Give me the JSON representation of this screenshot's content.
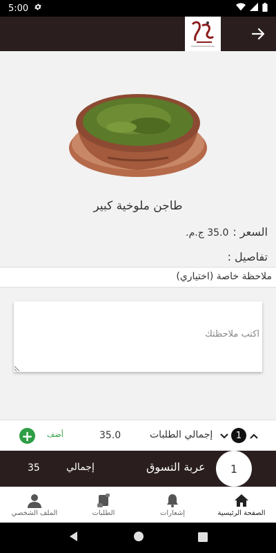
{
  "status_bar": {
    "time": "5:00"
  },
  "product": {
    "name": "طاجن ملوخية كبير",
    "price_label": "السعر :",
    "price_value": "35.0 ج.م.",
    "details_label": "تفاصيل :"
  },
  "note": {
    "title": "ملاحظة خاصة (اختياري)",
    "placeholder": "اكتب ملاحظتك"
  },
  "order_bar": {
    "add_label": "أضف",
    "total_value": "35.0",
    "total_label": "إجمالي الطلبات",
    "count": "1"
  },
  "cart_bar": {
    "count": "1",
    "label": "عربة التسوق",
    "total_label": "إجمالي",
    "total_value": "35"
  },
  "bottom_nav": {
    "items": [
      {
        "label": "الصفحة الرئيسية",
        "icon": "home-icon",
        "active": true
      },
      {
        "label": "إشعارات",
        "icon": "bell-icon",
        "active": false
      },
      {
        "label": "الطلبات",
        "icon": "scroll-icon",
        "active": false
      },
      {
        "label": "الملف الشخصي",
        "icon": "person-icon",
        "active": false
      }
    ]
  },
  "colors": {
    "header_bg": "#2a1e1e",
    "accent_green": "#2e9e44",
    "page_bg": "#f2f2f2"
  }
}
